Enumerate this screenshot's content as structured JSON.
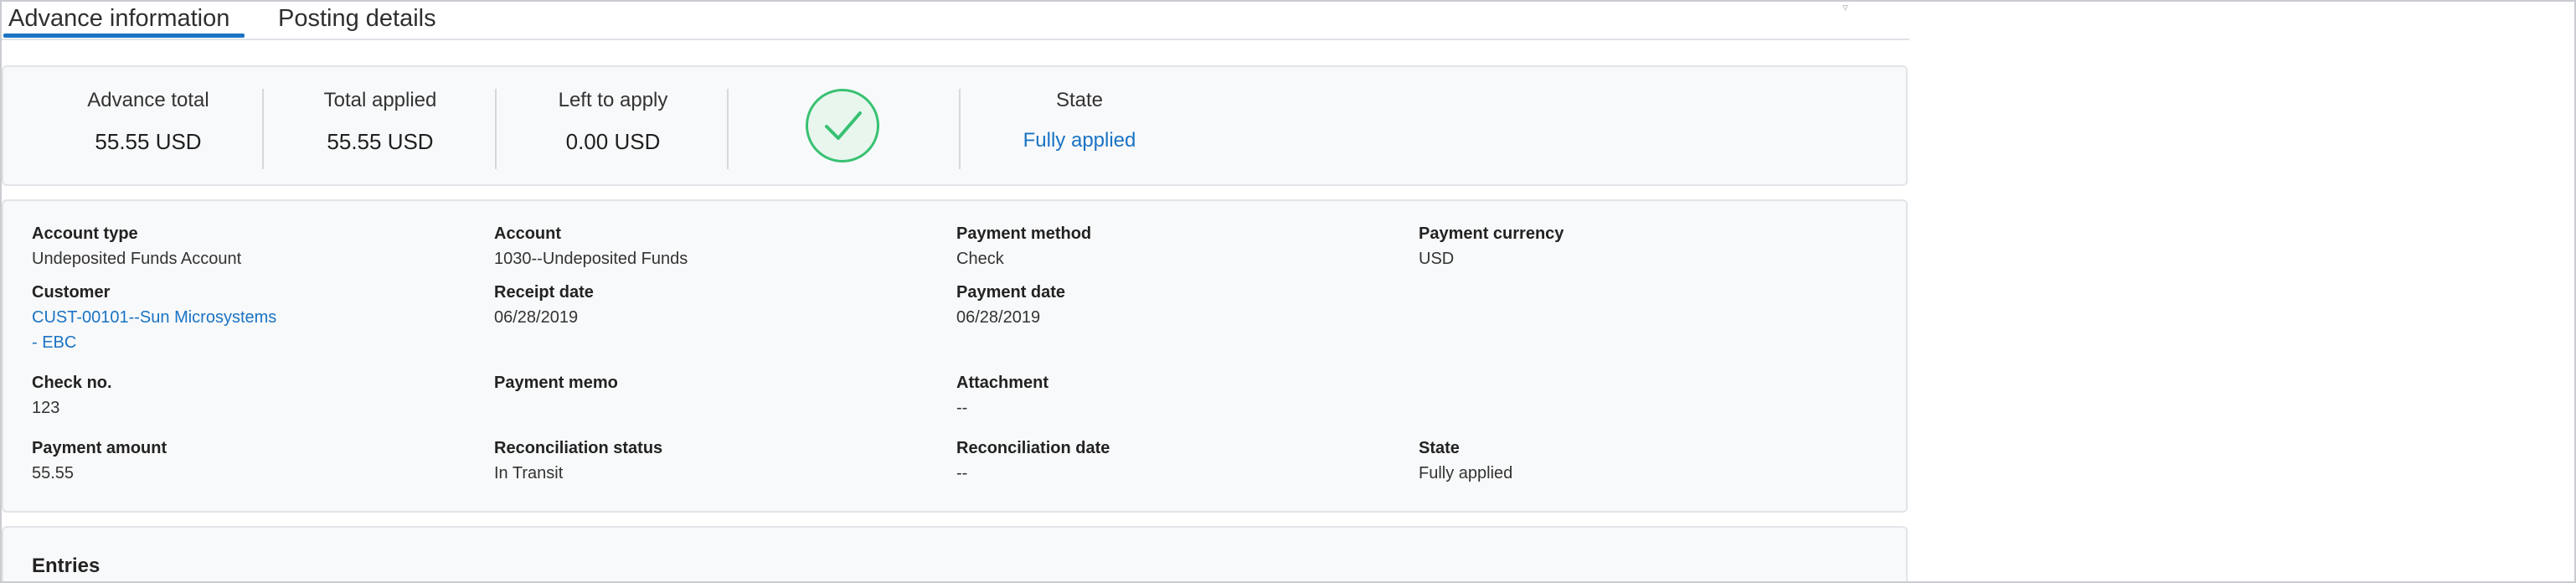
{
  "tabs": [
    {
      "label": "Advance information"
    },
    {
      "label": "Posting details"
    }
  ],
  "summary": {
    "advance_total": {
      "label": "Advance total",
      "value": "55.55 USD"
    },
    "total_applied": {
      "label": "Total applied",
      "value": "55.55 USD"
    },
    "left_to_apply": {
      "label": "Left to apply",
      "value": "0.00 USD"
    },
    "status_icon": "check-circle-icon",
    "state": {
      "label": "State",
      "value": "Fully applied"
    }
  },
  "details": {
    "account_type": {
      "label": "Account type",
      "value": "Undeposited Funds Account"
    },
    "account": {
      "label": "Account",
      "value": "1030--Undeposited Funds"
    },
    "payment_method": {
      "label": "Payment method",
      "value": "Check"
    },
    "payment_currency": {
      "label": "Payment currency",
      "value": "USD"
    },
    "customer": {
      "label": "Customer",
      "value_line1": "CUST-00101--Sun Microsystems",
      "value_line2": "- EBC"
    },
    "receipt_date": {
      "label": "Receipt date",
      "value": "06/28/2019"
    },
    "payment_date": {
      "label": "Payment date",
      "value": "06/28/2019"
    },
    "check_no": {
      "label": "Check no.",
      "value": "123"
    },
    "payment_memo": {
      "label": "Payment memo",
      "value": ""
    },
    "attachment": {
      "label": "Attachment",
      "value": "--"
    },
    "payment_amount": {
      "label": "Payment amount",
      "value": "55.55"
    },
    "reconciliation_status": {
      "label": "Reconciliation status",
      "value": "In Transit"
    },
    "reconciliation_date": {
      "label": "Reconciliation date",
      "value": "--"
    },
    "state": {
      "label": "State",
      "value": "Fully applied"
    }
  },
  "entries": {
    "title": "Entries"
  },
  "colors": {
    "accent": "#1a73c4",
    "success": "#38c172",
    "card_bg": "#f8f9fa"
  }
}
